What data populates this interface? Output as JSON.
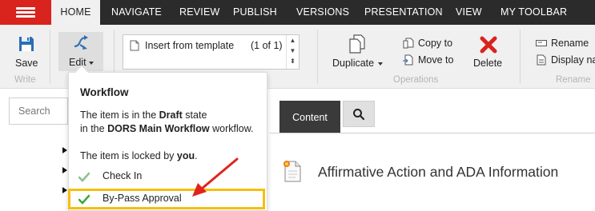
{
  "menu": {
    "tabs": [
      {
        "label": "HOME"
      },
      {
        "label": "NAVIGATE"
      },
      {
        "label": "REVIEW"
      },
      {
        "label": "PUBLISH"
      },
      {
        "label": "VERSIONS"
      },
      {
        "label": "PRESENTATION"
      },
      {
        "label": "VIEW"
      },
      {
        "label": "MY TOOLBAR"
      }
    ],
    "active_tab": "HOME"
  },
  "ribbon": {
    "save_label": "Save",
    "edit_label": "Edit",
    "write_group": "Write",
    "template_text": "Insert from template",
    "template_count": "(1 of 1)",
    "duplicate_label": "Duplicate",
    "copy_to_label": "Copy to",
    "move_to_label": "Move to",
    "delete_label": "Delete",
    "operations_group": "Operations",
    "rename_label": "Rename",
    "display_name_label": "Display na",
    "rename_group": "Rename"
  },
  "search": {
    "placeholder": "Search"
  },
  "content_tab": {
    "label": "Content"
  },
  "item": {
    "title": "Affirmative Action and ADA Information"
  },
  "workflow": {
    "title": "Workflow",
    "line1_pre": "The item is in the ",
    "line1_state": "Draft",
    "line1_post": " state",
    "line2_pre": "in the ",
    "line2_workflow": "DORS Main Workflow",
    "line2_post": " workflow.",
    "line3_pre": "The item is locked by ",
    "line3_user": "you",
    "line3_post": ".",
    "actions": [
      {
        "label": "Check In"
      },
      {
        "label": "By-Pass Approval"
      }
    ]
  },
  "colors": {
    "accent_red": "#d9231d",
    "highlight": "#f5bf0e",
    "check_green": "#3aa83a",
    "arrow_red": "#e0241c"
  }
}
